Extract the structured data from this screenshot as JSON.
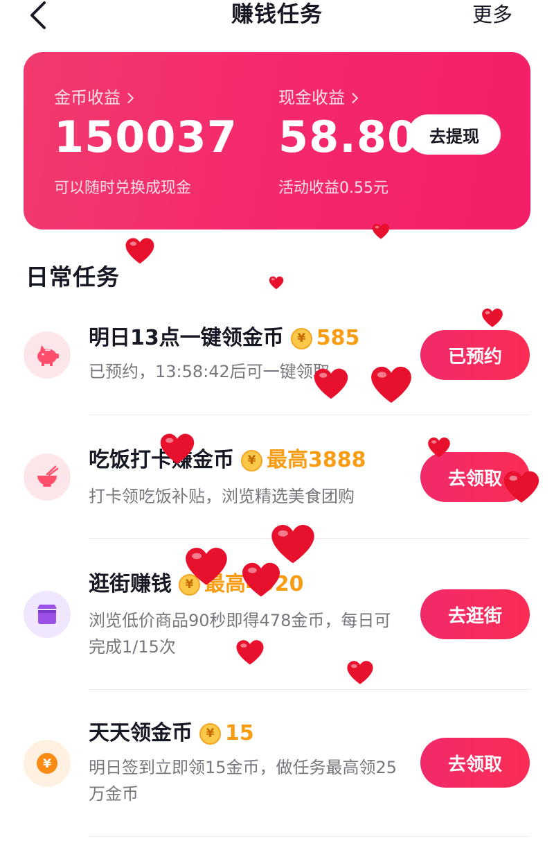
{
  "header": {
    "title": "赚钱任务",
    "more_label": "更多"
  },
  "earnings": {
    "coin_label": "金币收益",
    "coin_value": "150037",
    "coin_note": "可以随时兑换成现金",
    "cash_label": "现金收益",
    "cash_value": "58.80",
    "activity_note": "活动收益0.55元",
    "withdraw_label": "去提现",
    "colors": {
      "card_start": "#f23a6e",
      "card_end": "#f31e68"
    }
  },
  "daily": {
    "section_title": "日常任务",
    "tasks": [
      {
        "title": "明日13点一键领金币",
        "reward": "585",
        "desc": "已预约，13:58:42后可一键领取",
        "button": "已预约",
        "icon": "piggy-bank-icon",
        "icon_color": "#ff4f6d",
        "icon_bg": "#fde6ea"
      },
      {
        "title": "吃饭打卡赚金币",
        "reward": "最高3888",
        "desc": "打卡领吃饭补贴，浏览精选美食团购",
        "button": "去领取",
        "icon": "rice-bowl-icon",
        "icon_color": "#ff4f6d",
        "icon_bg": "#fde6ea"
      },
      {
        "title": "逛街赚钱",
        "reward": "最高4920",
        "desc": "浏览低价商品90秒即得478金币，每日可完成1/15次",
        "button": "去逛街",
        "icon": "shop-icon",
        "icon_color": "#9b51e8",
        "icon_bg": "#f0e6fd"
      },
      {
        "title": "天天领金币",
        "reward": "15",
        "desc": "明日签到立即领15金币，做任务最高领25万金币",
        "button": "去领取",
        "icon": "coin-yuan-icon",
        "icon_color": "#fa8c16",
        "icon_bg": "#fff1e2"
      }
    ]
  },
  "coin_symbol": "¥",
  "accent_color": "#fe2c55",
  "reward_color": "#f89c14"
}
